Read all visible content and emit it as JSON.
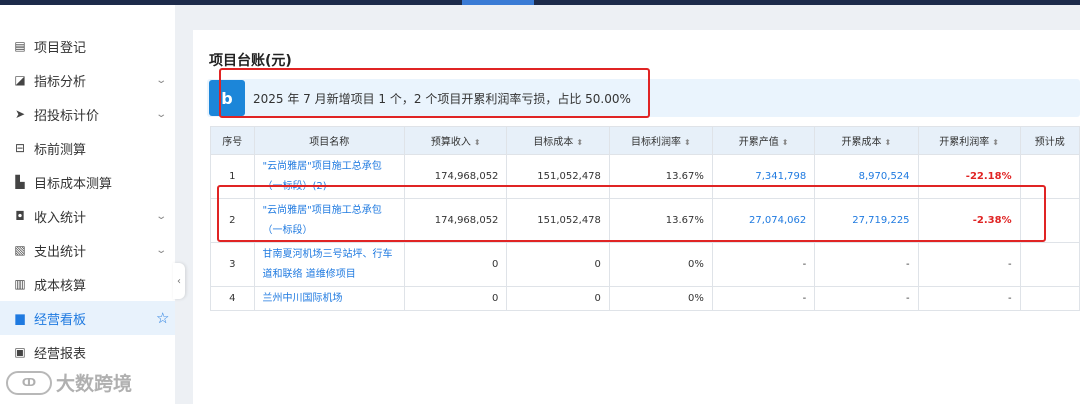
{
  "sidebar": {
    "items": [
      {
        "label": "项目登记",
        "icon": "id-card-icon",
        "has_chevron": false
      },
      {
        "label": "指标分析",
        "icon": "chart-icon",
        "has_chevron": true
      },
      {
        "label": "招投标计价",
        "icon": "send-icon",
        "has_chevron": true
      },
      {
        "label": "标前测算",
        "icon": "calc-icon",
        "has_chevron": false
      },
      {
        "label": "目标成本测算",
        "icon": "building-icon",
        "has_chevron": false
      },
      {
        "label": "收入统计",
        "icon": "briefcase-icon",
        "has_chevron": true
      },
      {
        "label": "支出统计",
        "icon": "receipt-icon",
        "has_chevron": true
      },
      {
        "label": "成本核算",
        "icon": "ledger-icon",
        "has_chevron": false
      },
      {
        "label": "经营看板",
        "icon": "monitor-icon",
        "active": true,
        "starred": true
      },
      {
        "label": "经营报表",
        "icon": "clipboard-icon",
        "has_chevron": false
      }
    ]
  },
  "watermark": {
    "logo": "ↀ",
    "text": "大数跨境"
  },
  "main": {
    "title": "项目台账(元)",
    "banner_icon": "b",
    "banner_text": "2025 年 7 月新增项目 1 个，2 个项目开累利润率亏损，占比 50.00%"
  },
  "table": {
    "headers": [
      "序号",
      "项目名称",
      "预算收入",
      "目标成本",
      "目标利润率",
      "开累产值",
      "开累成本",
      "开累利润率",
      "预计成"
    ],
    "rows": [
      {
        "no": "1",
        "name": "\"云尚雅居\"项目施工总承包（一标段）(2)",
        "budget": "174,968,052",
        "target_cost": "151,052,478",
        "target_margin": "13.67%",
        "output": "7,341,798",
        "cost": "8,970,524",
        "margin": "-22.18%"
      },
      {
        "no": "2",
        "name": "\"云尚雅居\"项目施工总承包（一标段）",
        "budget": "174,968,052",
        "target_cost": "151,052,478",
        "target_margin": "13.67%",
        "output": "27,074,062",
        "cost": "27,719,225",
        "margin": "-2.38%"
      },
      {
        "no": "3",
        "name": "甘南夏河机场三号站坪、行车道和联络 道维修项目",
        "budget": "0",
        "target_cost": "0",
        "target_margin": "0%",
        "output": "-",
        "cost": "-",
        "margin": "-"
      },
      {
        "no": "4",
        "name": "兰州中川国际机场",
        "budget": "0",
        "target_cost": "0",
        "target_margin": "0%",
        "output": "-",
        "cost": "-",
        "margin": "-"
      }
    ]
  },
  "colors": {
    "accent": "#1f7ae0",
    "negative": "#e02424",
    "header_bg": "#e7f0f9",
    "banner_bg": "#eaf4fd"
  }
}
